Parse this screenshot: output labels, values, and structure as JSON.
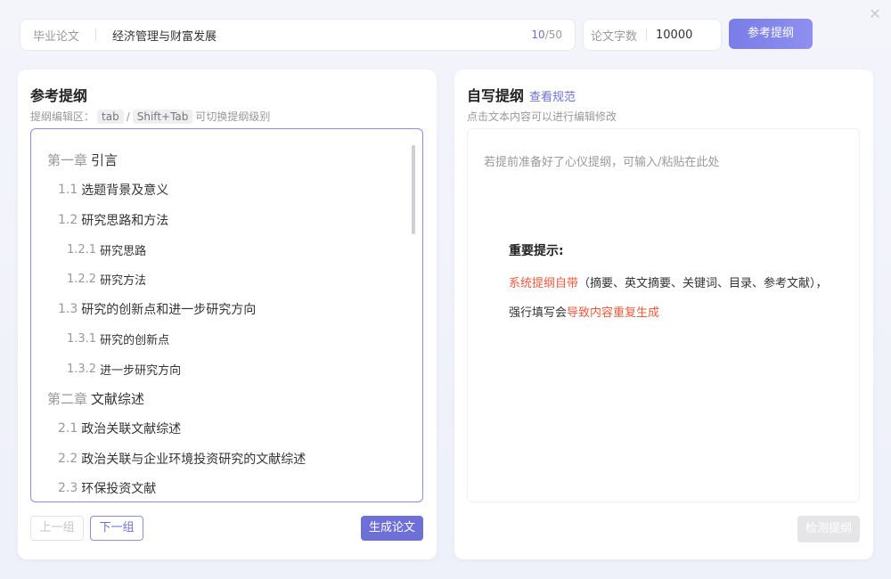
{
  "topbar": {
    "type_label": "毕业论文",
    "title_value": "经济管理与财富发展",
    "count_current": "10",
    "count_max": "/50",
    "words_label": "论文字数",
    "words_value": "10000",
    "ref_button": "参考提纲"
  },
  "left_panel": {
    "title": "参考提纲",
    "sub_prefix": "提纲编辑区：",
    "key_tab": "tab",
    "key_sep": "/",
    "key_shift_tab": "Shift+Tab",
    "sub_suffix": "可切换提纲级别",
    "outline": [
      {
        "num": "第一章",
        "text": "引言",
        "level": 1
      },
      {
        "num": "1.1",
        "text": "选题背景及意义",
        "level": 2
      },
      {
        "num": "1.2",
        "text": "研究思路和方法",
        "level": 2
      },
      {
        "num": "1.2.1",
        "text": "研究思路",
        "level": 3
      },
      {
        "num": "1.2.2",
        "text": "研究方法",
        "level": 3
      },
      {
        "num": "1.3",
        "text": "研究的创新点和进一步研究方向",
        "level": 2
      },
      {
        "num": "1.3.1",
        "text": "研究的创新点",
        "level": 3
      },
      {
        "num": "1.3.2",
        "text": "进一步研究方向",
        "level": 3
      },
      {
        "num": "第二章",
        "text": "文献综述",
        "level": 1
      },
      {
        "num": "2.1",
        "text": "政治关联文献综述",
        "level": 2
      },
      {
        "num": "2.2",
        "text": "政治关联与企业环境投资研究的文献综述",
        "level": 2
      },
      {
        "num": "2.3",
        "text": "环保投资文献",
        "level": 2
      }
    ],
    "prev_button": "上一组",
    "next_button": "下一组",
    "generate_button": "生成论文"
  },
  "right_panel": {
    "title": "自写提纲",
    "link": "查看规范",
    "subtitle": "点击文本内容可以进行编辑修改",
    "placeholder": "若提前准备好了心仪提纲，可输入/粘贴在此处",
    "notice_title": "重要提示:",
    "notice_line1_red": "系统提纲自带",
    "notice_line1_rest": "（摘要、英文摘要、关键词、目录、参考文献），",
    "notice_line2_prefix": "强行填写会",
    "notice_line2_red": "导致内容重复生成",
    "check_button": "检测提纲"
  },
  "close_icon": "close-icon"
}
